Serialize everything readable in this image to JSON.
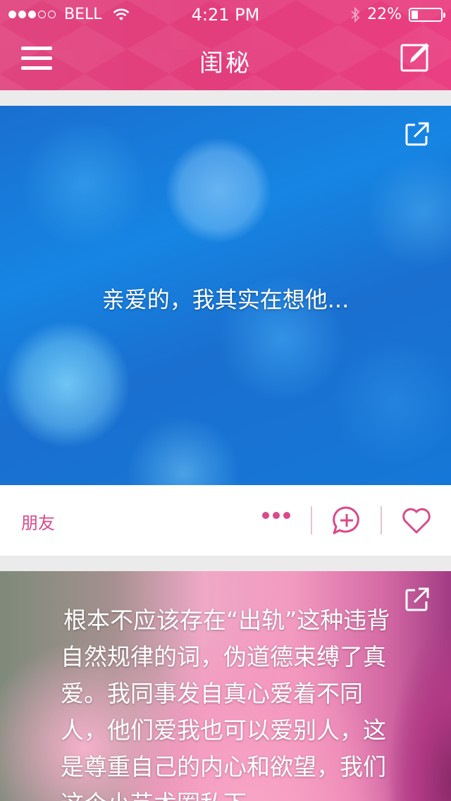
{
  "status_bar": {
    "carrier": "BELL",
    "time": "4:21 PM",
    "battery": "22%",
    "battery_level": 0.22,
    "signal_bars_filled": 3,
    "signal_bars_total": 5
  },
  "nav": {
    "title": "闺秘",
    "menu_icon": "hamburger-menu-icon",
    "compose_icon": "compose-icon"
  },
  "posts": [
    {
      "text": "亲爱的，我其实在想他...",
      "tag": "朋友",
      "share_icon": "share-external-icon",
      "more_icon": "more-dots-icon",
      "comment_icon": "comment-plus-icon",
      "like_icon": "heart-icon"
    },
    {
      "text": "根本不应该存在“出轨”这种违背自然规律的词，伪道德束缚了真爱。我同事发自真心爱着不同人，他们爱我也可以爱别人，这是尊重自己的内心和欲望，我们这个小艺术圈私下",
      "share_icon": "share-external-icon"
    }
  ],
  "colors": {
    "accent": "#e23d7c",
    "footer_accent": "#d94a8a",
    "background": "#ebebeb"
  }
}
